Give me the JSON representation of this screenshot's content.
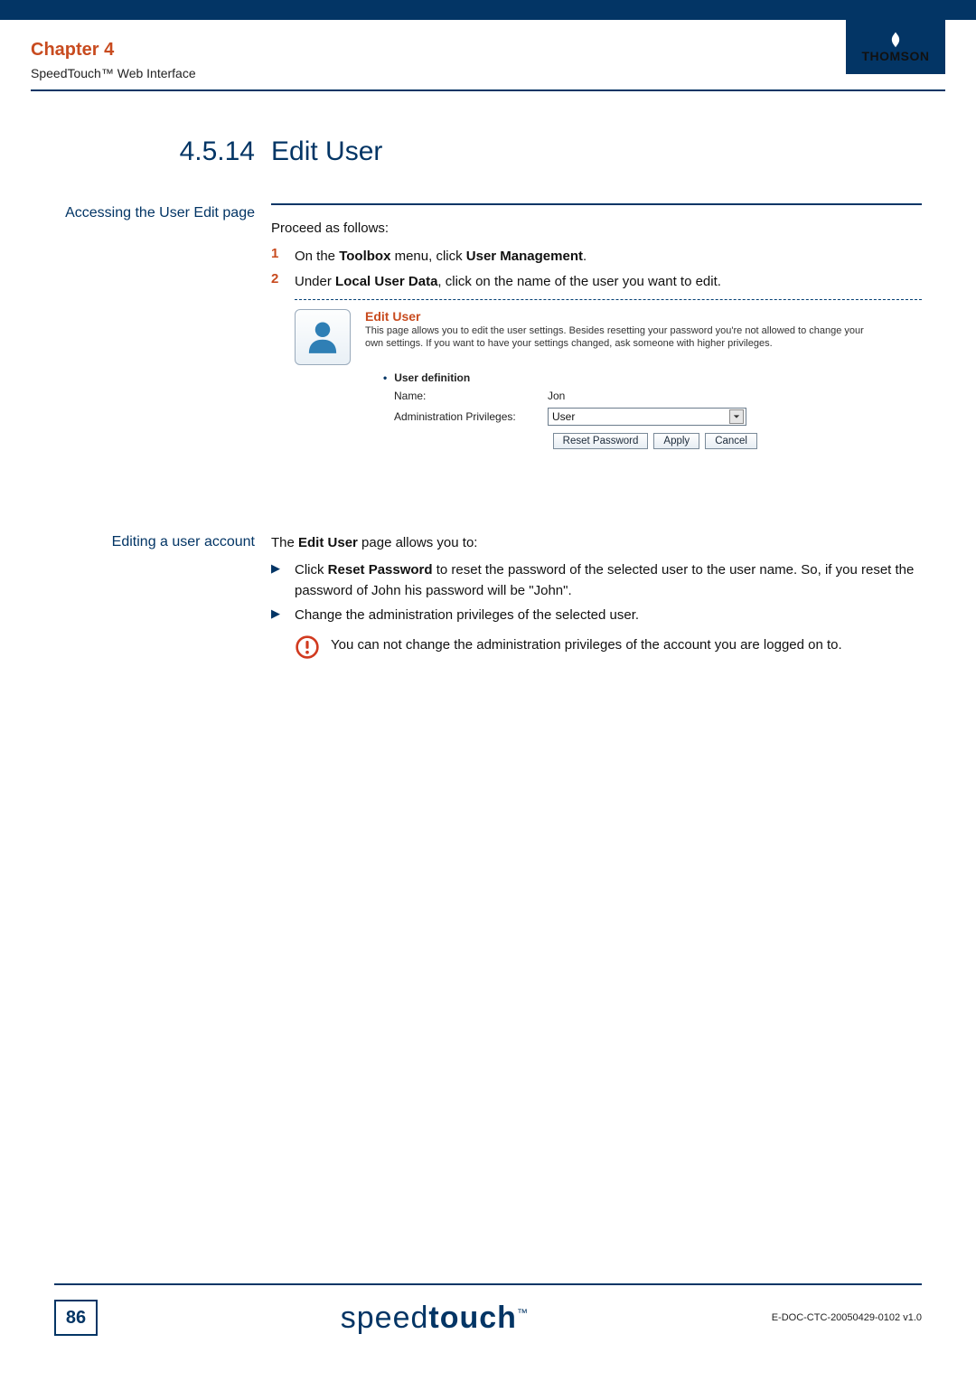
{
  "header": {
    "chapter": "Chapter 4",
    "subtitle": "SpeedTouch™ Web Interface",
    "brand": "THOMSON"
  },
  "section": {
    "number": "4.5.14",
    "title": "Edit User"
  },
  "access": {
    "side_label": "Accessing the User Edit page",
    "intro": "Proceed as follows:",
    "steps": [
      {
        "num": "1",
        "pre": "On the ",
        "b1": "Toolbox",
        "mid": " menu, click ",
        "b2": "User Management",
        "post": "."
      },
      {
        "num": "2",
        "pre": "Under ",
        "b1": "Local User Data",
        "mid": ", click on the name of the user you want to edit.",
        "b2": "",
        "post": ""
      }
    ]
  },
  "screenshot": {
    "title": "Edit User",
    "desc": "This page allows you to edit the user settings. Besides resetting your password you're not allowed to change your own settings. If you want to have your settings changed, ask someone with higher privileges.",
    "sub_heading": "User definition",
    "name_label": "Name:",
    "name_value": "Jon",
    "priv_label": "Administration Privileges:",
    "priv_value": "User",
    "buttons": {
      "reset": "Reset Password",
      "apply": "Apply",
      "cancel": "Cancel"
    }
  },
  "editing": {
    "side_label": "Editing a user account",
    "intro_pre": "The ",
    "intro_b": "Edit User",
    "intro_post": " page allows you to:",
    "items": [
      {
        "pre": "Click ",
        "b": "Reset Password",
        "post": " to reset the password of the selected user to the user name. So, if you reset the password of John his password will be \"John\"."
      },
      {
        "pre": "",
        "b": "",
        "post": "Change the administration privileges of the selected user."
      }
    ],
    "note": "You can not change the administration privileges of the account you are logged on to."
  },
  "footer": {
    "page": "86",
    "logo_thin": "speed",
    "logo_bold": "touch",
    "docid": "E-DOC-CTC-20050429-0102 v1.0"
  }
}
